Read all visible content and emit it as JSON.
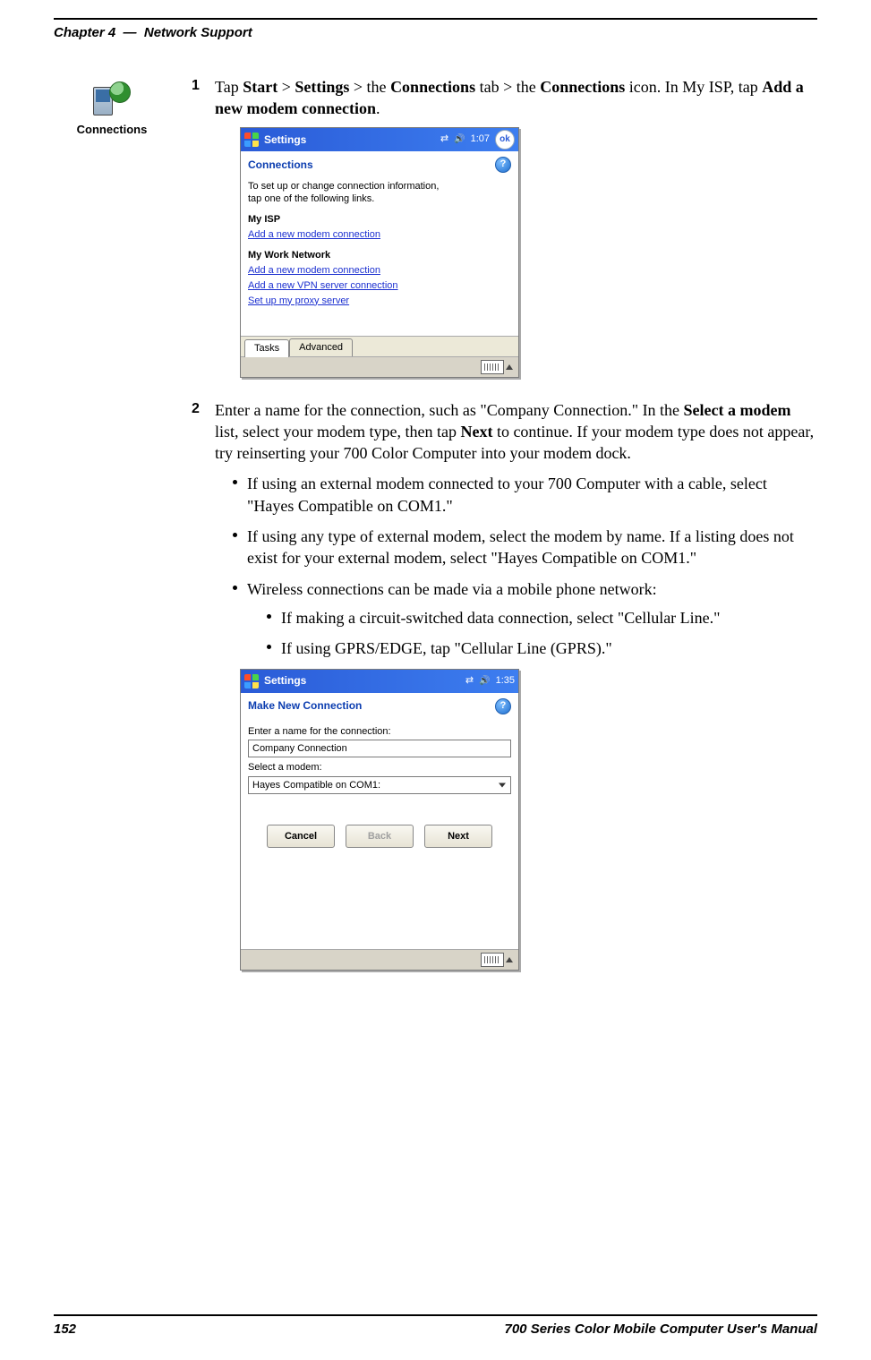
{
  "header": {
    "chapter": "Chapter 4",
    "section": "Network Support"
  },
  "footer": {
    "page": "152",
    "manual": "700 Series Color Mobile Computer User's Manual"
  },
  "sidebar": {
    "icon_label": "Connections"
  },
  "step1": {
    "num": "1",
    "pre": "Tap ",
    "start": "Start",
    "gt1": " > ",
    "settings": "Settings",
    "gt2": " > the ",
    "conn_tab": "Connections",
    "gt3": " tab > the ",
    "conn_icon": "Connections",
    "after_icon": " icon. In My ISP, tap ",
    "add_link": "Add a new modem connection",
    "period": "."
  },
  "ss1": {
    "title": "Settings",
    "time": "1:07",
    "ok": "ok",
    "subtitle": "Connections",
    "help": "?",
    "intro_l1": "To set up or change connection information,",
    "intro_l2": "tap one of the following links.",
    "sec1": "My ISP",
    "sec1_l1": "Add a new modem connection",
    "sec2": "My Work Network",
    "sec2_l1": "Add a new modem connection",
    "sec2_l2": "Add a new VPN server connection",
    "sec2_l3": "Set up my proxy server",
    "tab1": "Tasks",
    "tab2": "Advanced"
  },
  "step2": {
    "num": "2",
    "p1a": "Enter a name for the connection, such as \"Company Connection.\" In the ",
    "p1b": "Select a modem",
    "p1c": " list, select your modem type, then tap ",
    "p1d": "Next",
    "p1e": " to continue. If your modem type does not appear, try reinserting your 700 Color Computer into your modem dock.",
    "b1": "If using an external modem connected to your 700 Computer with a cable, select \"Hayes Compatible on COM1.\"",
    "b2": "If using any type of external modem, select the modem by name. If a listing does not exist for your external modem, select \"Hayes Compatible on COM1.\"",
    "b3": "Wireless connections can be made via a mobile phone network:",
    "b3a": "If making a circuit-switched data connection, select \"Cellular Line.\"",
    "b3b": "If using GPRS/EDGE, tap \"Cellular Line (GPRS).\""
  },
  "ss2": {
    "title": "Settings",
    "time": "1:35",
    "subtitle": "Make New Connection",
    "help": "?",
    "label1": "Enter a name for the connection:",
    "input1": "Company Connection",
    "label2": "Select a modem:",
    "select1": "Hayes Compatible on COM1:",
    "btn_cancel": "Cancel",
    "btn_back": "Back",
    "btn_next": "Next"
  }
}
